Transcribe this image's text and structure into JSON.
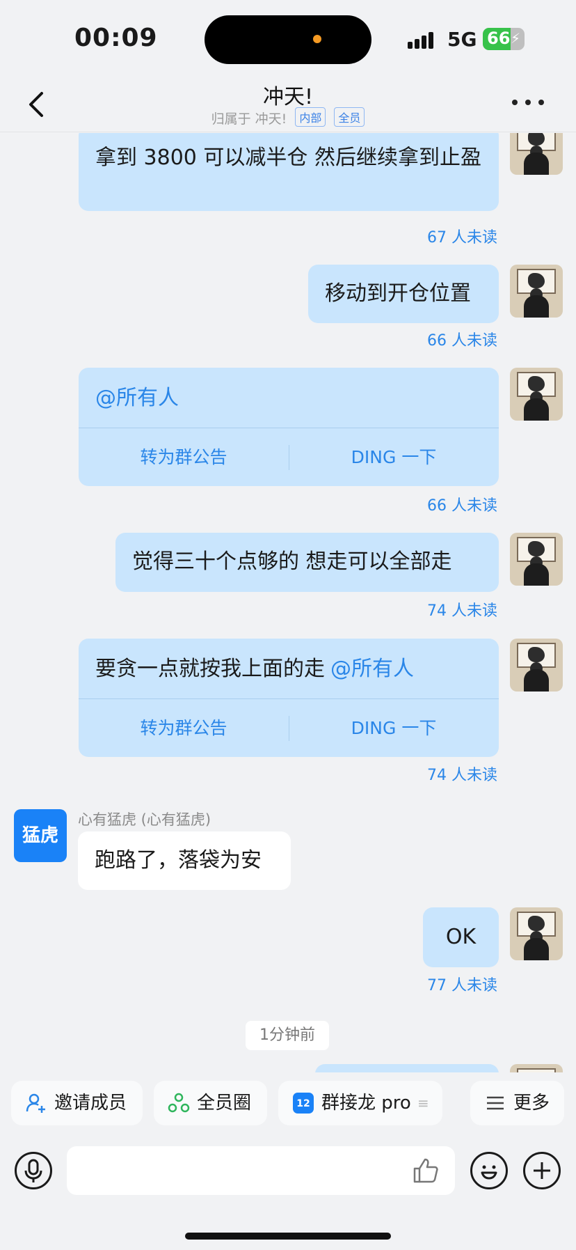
{
  "status_bar": {
    "time": "00:09",
    "network": "5G",
    "battery": "66",
    "battery_level": 0.66,
    "battery_color": "#37c24a"
  },
  "nav": {
    "title": "冲天!",
    "subtitle": "归属于 冲天!",
    "tags": [
      "内部",
      "全员"
    ],
    "back_icon": "chevron-left-icon",
    "more_icon": "more-dots-icon"
  },
  "messages": [
    {
      "text": "拿到 3800 可以减半仓 然后继续拿到止盈",
      "unread": "67 人未读"
    },
    {
      "text": "移动到开仓位置",
      "unread": "66 人未读"
    },
    {
      "mention": "@所有人",
      "actions": [
        "转为群公告",
        "DING 一下"
      ],
      "unread": "66 人未读"
    },
    {
      "text": "觉得三十个点够的 想走可以全部走",
      "unread": "74 人未读"
    },
    {
      "text": "要贪一点就按我上面的走",
      "mention": "@所有人",
      "actions": [
        "转为群公告",
        "DING 一下"
      ],
      "unread": "74 人未读"
    },
    {
      "sender": "心有猛虎 (心有猛虎)",
      "avatar_label": "猛虎",
      "text": "跑路了，落袋为安"
    },
    {
      "text": "OK",
      "unread": "77 人未读"
    }
  ],
  "timestamp": "1分钟前",
  "quick_actions": [
    {
      "label": "邀请成员",
      "icon": "invite-member-icon"
    },
    {
      "label": "全员圈",
      "icon": "circle-group-icon"
    },
    {
      "label": "群接龙 pro",
      "icon": "solitaire-app-icon"
    },
    {
      "label": "更多",
      "icon": "menu-lines-icon"
    }
  ],
  "input": {
    "placeholder": "",
    "voice_icon": "microphone-icon",
    "like_icon": "thumbs-up-icon",
    "emoji_icon": "emoji-icon",
    "add_icon": "plus-icon"
  },
  "colors": {
    "accent": "#2a86e8",
    "my_bubble": "#c9e5fd",
    "background": "#f1f2f4",
    "tiger_avatar": "#1a82f7"
  }
}
